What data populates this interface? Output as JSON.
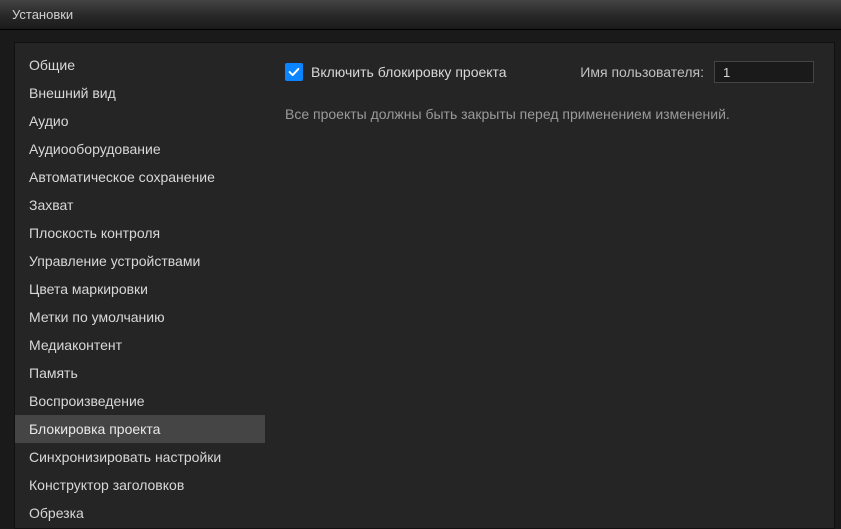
{
  "window": {
    "title": "Установки"
  },
  "sidebar": {
    "items": [
      {
        "label": "Общие"
      },
      {
        "label": "Внешний вид"
      },
      {
        "label": "Аудио"
      },
      {
        "label": "Аудиооборудование"
      },
      {
        "label": "Автоматическое сохранение"
      },
      {
        "label": "Захват"
      },
      {
        "label": "Плоскость контроля"
      },
      {
        "label": "Управление устройствами"
      },
      {
        "label": "Цвета маркировки"
      },
      {
        "label": "Метки по умолчанию"
      },
      {
        "label": "Медиаконтент"
      },
      {
        "label": "Память"
      },
      {
        "label": "Воспроизведение"
      },
      {
        "label": "Блокировка проекта"
      },
      {
        "label": "Синхронизировать настройки"
      },
      {
        "label": "Конструктор заголовков"
      },
      {
        "label": "Обрезка"
      }
    ],
    "selected_index": 13
  },
  "main": {
    "enable_lock_label": "Включить блокировку проекта",
    "enable_lock_checked": true,
    "username_label": "Имя пользователя:",
    "username_value": "1",
    "info_text": "Все проекты должны быть закрыты перед применением изменений."
  }
}
